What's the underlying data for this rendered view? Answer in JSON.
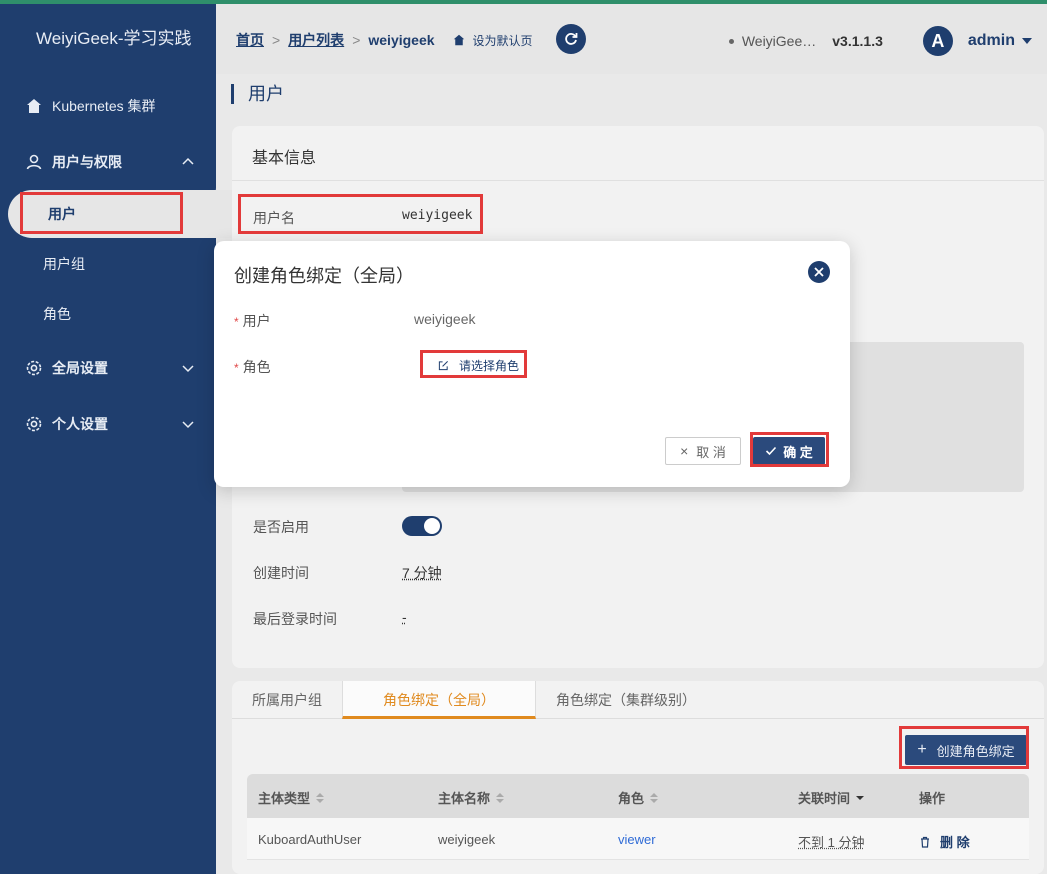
{
  "brand": "WeiyiGeek-学习实践",
  "sidebar": {
    "items": [
      {
        "label": "Kubernetes 集群",
        "icon": "home-icon"
      },
      {
        "label": "用户与权限",
        "icon": "user-icon"
      },
      {
        "label": "全局设置",
        "icon": "gear-icon"
      },
      {
        "label": "个人设置",
        "icon": "gear-icon"
      }
    ],
    "sub_items": [
      "用户",
      "用户组",
      "角色"
    ]
  },
  "header": {
    "crumb_home": "首页",
    "crumb_list": "用户列表",
    "crumb_current": "weiyigeek",
    "set_default": "设为默认页",
    "site": "WeiyiGee…",
    "version": "v3.1.1.3",
    "avatar_letter": "A",
    "username": "admin"
  },
  "page": {
    "title": "用户",
    "basic_info_title": "基本信息",
    "username_label": "用户名",
    "username_value": "weiyigeek",
    "enabled_label": "是否启用",
    "enabled": true,
    "created_label": "创建时间",
    "created_value": "7 分钟",
    "last_login_label": "最后登录时间",
    "last_login_value": "-"
  },
  "tabs": {
    "items": [
      "所属用户组",
      "角色绑定（全局）",
      "角色绑定（集群级别）"
    ],
    "active": 1,
    "create_button": "创建角色绑定"
  },
  "table": {
    "headers": [
      "主体类型",
      "主体名称",
      "角色",
      "关联时间",
      "操作"
    ],
    "rows": [
      {
        "type": "KuboardAuthUser",
        "name": "weiyigeek",
        "role": "viewer",
        "time": "不到 1 分钟",
        "action": "删 除"
      }
    ]
  },
  "modal": {
    "title": "创建角色绑定（全局）",
    "user_label": "用户",
    "user_value": "weiyigeek",
    "role_label": "角色",
    "role_placeholder": "请选择角色",
    "cancel": "取 消",
    "ok": "确 定"
  },
  "colors": {
    "primary": "#1f3e6e",
    "accent": "#e08a1e",
    "highlight": "#e23a3a"
  }
}
